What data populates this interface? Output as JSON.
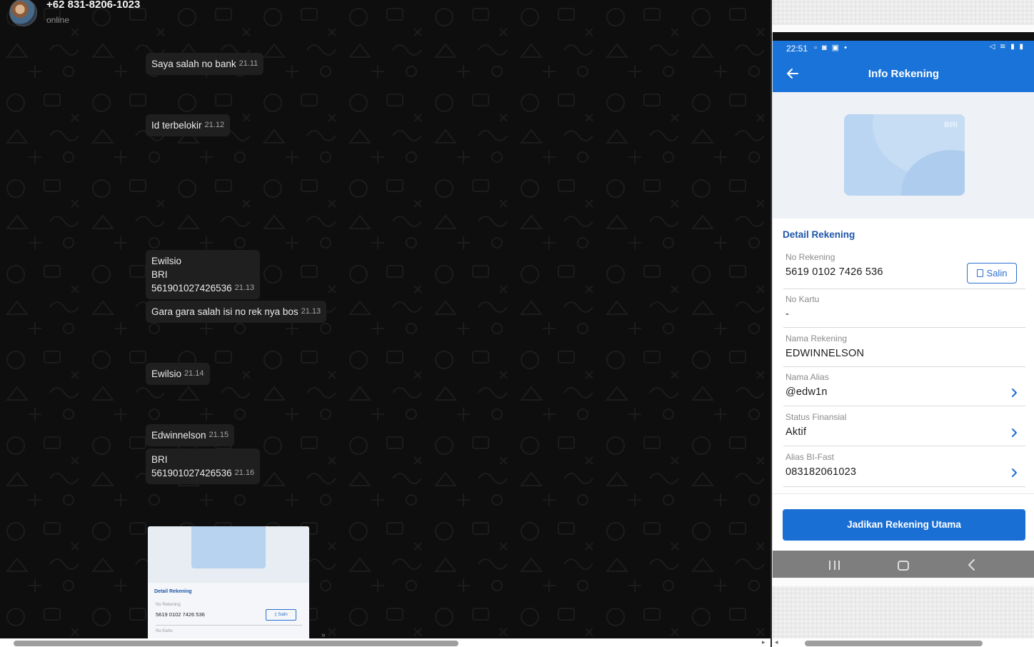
{
  "chat": {
    "contact_name": "+62 831-8206-1023",
    "contact_status": "online",
    "messages": [
      {
        "text": "Saya salah no bank",
        "time": "21.11"
      },
      {
        "text": "Id terbelokir",
        "time": "21.12"
      },
      {
        "text_lines": [
          "Ewilsio",
          "BRI",
          "561901027426536"
        ],
        "time": "21.13"
      },
      {
        "text": "Gara gara salah isi no rek nya bos",
        "time": "21.13"
      },
      {
        "text": "Ewilsio",
        "time": "21.14"
      },
      {
        "text": "Edwinnelson",
        "time": "21.15"
      },
      {
        "text_lines": [
          "BRI",
          "561901027426536"
        ],
        "time": "21.16"
      }
    ],
    "thumbnail": {
      "section_title": "Detail Rekening",
      "label": "No Rekening",
      "value": "5619 0102 7426 536",
      "copy_label": "Salin",
      "label2": "No Kartu"
    }
  },
  "phone": {
    "status_time": "22:51",
    "title": "Info Rekening",
    "card_brand": "BRI",
    "section_title": "Detail Rekening",
    "copy_label": "Salin",
    "fields": [
      {
        "label": "No Rekening",
        "value": "5619 0102 7426 536"
      },
      {
        "label": "No Kartu",
        "value": "-"
      },
      {
        "label": "Nama Rekening",
        "value": "EDWINNELSON"
      },
      {
        "label": "Nama Alias",
        "value": "@edw1n"
      },
      {
        "label": "Status Finansial",
        "value": "Aktif"
      },
      {
        "label": "Alias BI-Fast",
        "value": "083182061023"
      }
    ],
    "primary_button": "Jadikan Rekening Utama"
  },
  "colors": {
    "bubble": "#1f1f1f",
    "chat_bg": "#0e0e0e",
    "brand_blue": "#1a73d9",
    "section_blue": "#1f56a8"
  }
}
